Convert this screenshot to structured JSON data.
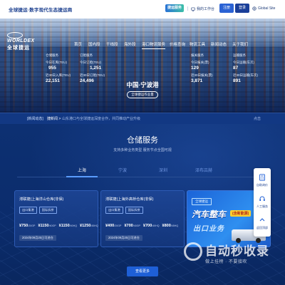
{
  "topbar": {
    "slogan": "全球捷运·数字现代生态捷运商",
    "badge_label": "捷运服务",
    "workbench_label": "我的工作台",
    "register_label": "注册",
    "login_label": "登录",
    "global_site_label": "Global Site"
  },
  "brand": {
    "en": "WORLDEX",
    "cn": "全球捷运"
  },
  "nav": {
    "items": [
      "首页",
      "国内段",
      "干线段",
      "海外段",
      "港口物流服务",
      "价格查询",
      "物流工具",
      "新闻动态",
      "关于我们"
    ],
    "active_index": 4
  },
  "stats_left": [
    {
      "label": "仓储服务",
      "value": ""
    },
    {
      "label": "今日在库(TEU)",
      "value": "955"
    },
    {
      "label": "近30日入库(TEU)",
      "value": "22,151"
    }
  ],
  "stats_left2": [
    {
      "label": "订舱服务",
      "value": ""
    },
    {
      "label": "今日订舱(TEU)",
      "value": "1,251"
    },
    {
      "label": "近30日订舱(TEU)",
      "value": "24,496"
    }
  ],
  "stats_right": [
    {
      "label": "报关服务",
      "value": ""
    },
    {
      "label": "今日报关(票)",
      "value": "129"
    },
    {
      "label": "近30日报关(票)",
      "value": "3,871"
    }
  ],
  "stats_right2": [
    {
      "label": "运输服务",
      "value": ""
    },
    {
      "label": "今日运输(车次)",
      "value": "87"
    },
    {
      "label": "近30日运输(车次)",
      "value": "891"
    }
  ],
  "hero_center": {
    "title": "中国·宁波港",
    "subtitle": "全球捷运作业量"
  },
  "notice": {
    "tag": "[新闻动态]",
    "sub": "捷新闻 >",
    "text": "· 山东港口与全球捷运深度合作，共同推动产业升级",
    "more": "点击"
  },
  "section": {
    "title": "仓储服务",
    "subtitle": "支持多种业务类型 服务节点全国可视",
    "tabs": [
      "上海",
      "宁波",
      "深圳",
      "泽布吕赫"
    ],
    "active_tab": 0,
    "more_label": "查看更多"
  },
  "cards": [
    {
      "title": "滞联捷(上海洋山仓库(非保)",
      "tags": [
        "出口集港",
        "国际拆拼"
      ],
      "prices": [
        {
          "value": "¥750",
          "unit": "/20GP"
        },
        {
          "value": "¥1150",
          "unit": "/40GP"
        },
        {
          "value": "¥1150",
          "unit": "/40HQ"
        },
        {
          "value": "¥1250",
          "unit": "/45HQ"
        }
      ],
      "date": "2024年09月25日可进仓"
    },
    {
      "title": "滞联捷(上海外高桥仓库(非保)",
      "tags": [
        "出口集港",
        "国际拆拼"
      ],
      "prices": [
        {
          "value": "¥400",
          "unit": "/20GP"
        },
        {
          "value": "¥700",
          "unit": "/40GP"
        },
        {
          "value": "¥700",
          "unit": "/40HQ"
        },
        {
          "value": "¥800",
          "unit": "/45HQ"
        }
      ],
      "date": "2024年09月25日可进仓"
    }
  ],
  "ad": {
    "tag": "全球捷运",
    "big": "汽车整车",
    "badge": "(含新能源)",
    "line2": "出口业务"
  },
  "float_bar": {
    "items": [
      "自助询价",
      "人工服务",
      "返回顶部"
    ]
  },
  "watermark": {
    "text": "自动秒收录",
    "sub": "做上挂榜 · 不要接吹"
  },
  "colors": {
    "primary": "#1e5fd6",
    "navy": "#0a2a66",
    "accent": "#5a9cff"
  }
}
